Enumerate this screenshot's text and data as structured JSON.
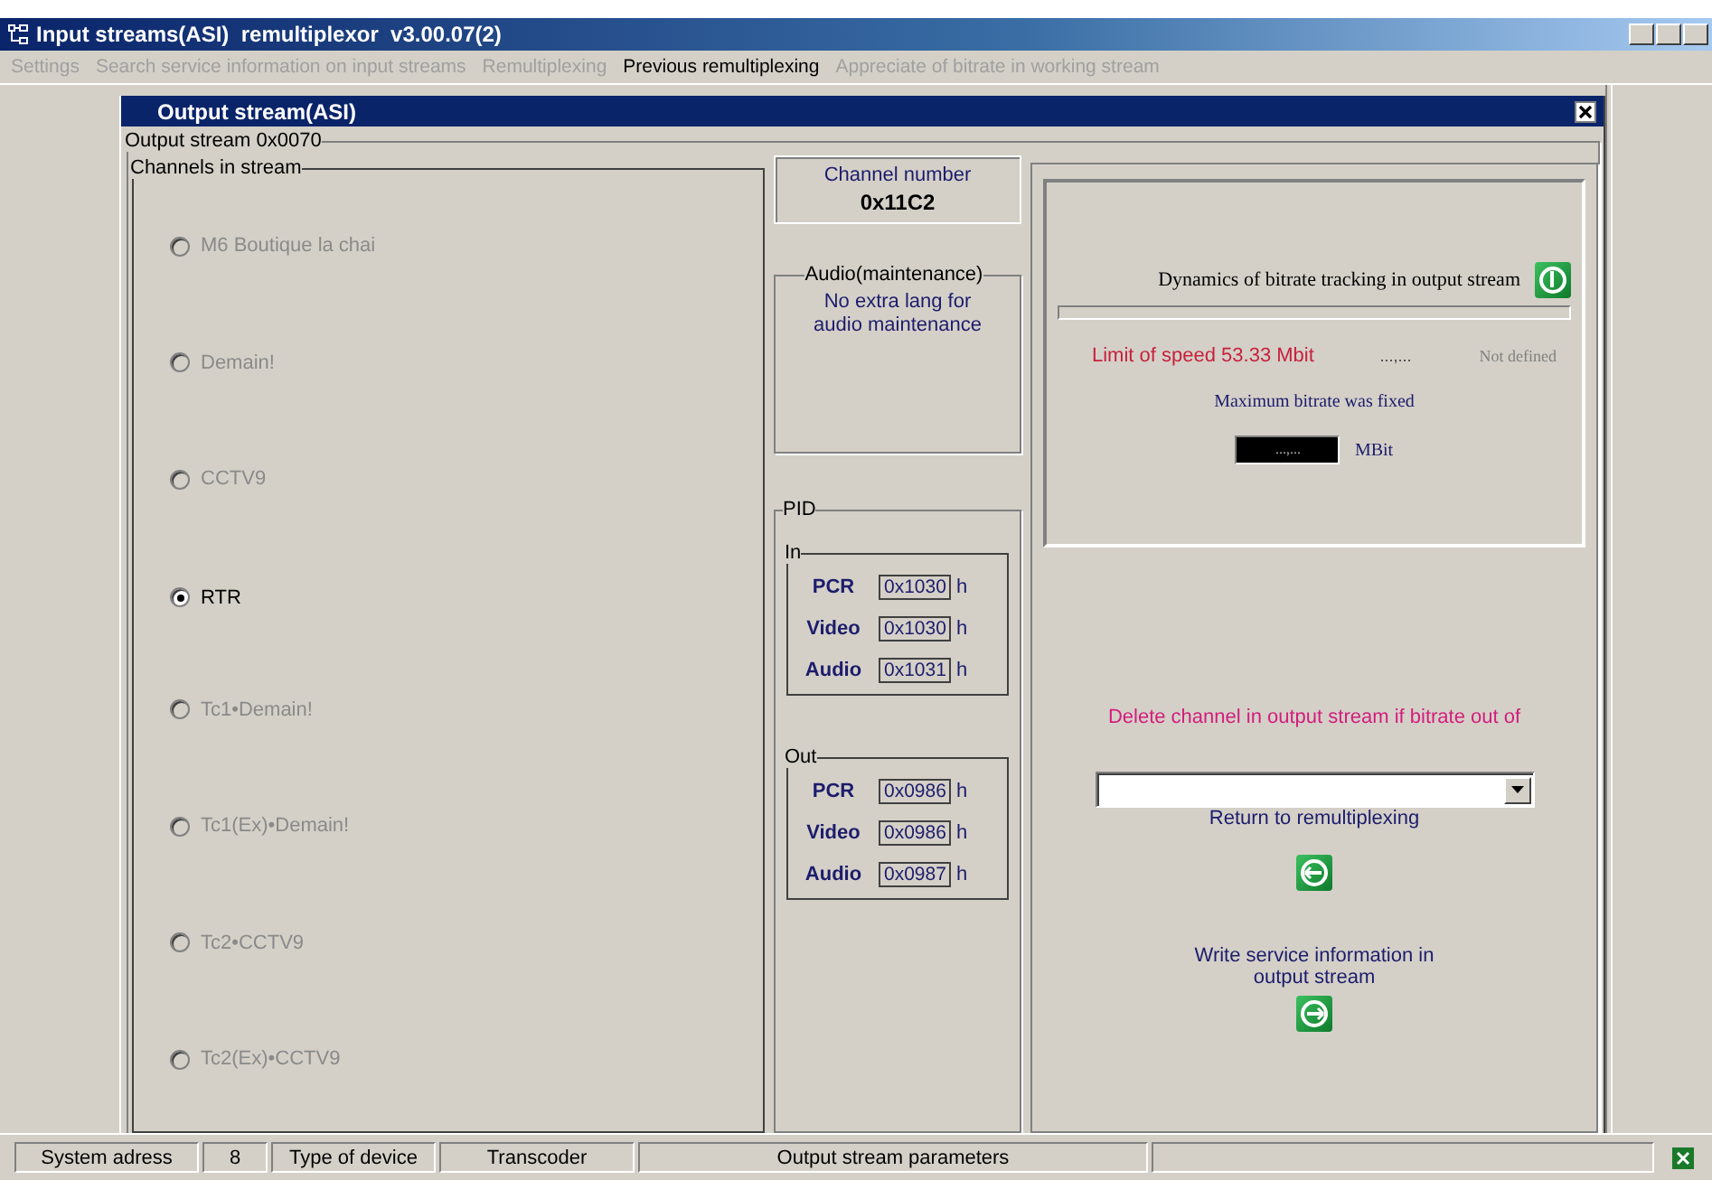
{
  "window": {
    "title": "Input streams(ASI)  remultiplexor  v3.00.07(2)"
  },
  "menu": [
    {
      "label": "Settings",
      "disabled": true
    },
    {
      "label": "Search service information on input streams",
      "disabled": true
    },
    {
      "label": "Remultiplexing",
      "disabled": true
    },
    {
      "label": "Previous remultiplexing",
      "disabled": false
    },
    {
      "label": "Appreciate of bitrate in working stream",
      "disabled": true
    }
  ],
  "dialog": {
    "title": "Output stream(ASI)",
    "group_title": "Output stream 0x0070"
  },
  "channels": {
    "title": "Channels in stream",
    "items": [
      {
        "label": "M6 Boutique la chai",
        "selected": false,
        "disabled": true
      },
      {
        "label": "Demain!",
        "selected": false,
        "disabled": true
      },
      {
        "label": "CCTV9",
        "selected": false,
        "disabled": true
      },
      {
        "label": "RTR",
        "selected": true,
        "disabled": false
      },
      {
        "label": "Tc1•Demain!",
        "selected": false,
        "disabled": true
      },
      {
        "label": "Tc1(Ex)•Demain!",
        "selected": false,
        "disabled": true
      },
      {
        "label": "Tc2•CCTV9",
        "selected": false,
        "disabled": true
      },
      {
        "label": "Tc2(Ex)•CCTV9",
        "selected": false,
        "disabled": true
      }
    ]
  },
  "channel_number": {
    "label": "Channel number",
    "value": "0x11C2"
  },
  "audio": {
    "title": "Audio(maintenance)",
    "text": "No extra lang for audio maintenance"
  },
  "pid": {
    "title": "PID",
    "groups": [
      {
        "title": "In",
        "rows": [
          {
            "label": "PCR",
            "value": "0x1030",
            "unit": "h"
          },
          {
            "label": "Video",
            "value": "0x1030",
            "unit": "h"
          },
          {
            "label": "Audio",
            "value": "0x1031",
            "unit": "h"
          }
        ]
      },
      {
        "title": "Out",
        "rows": [
          {
            "label": "PCR",
            "value": "0x0986",
            "unit": "h"
          },
          {
            "label": "Video",
            "value": "0x0986",
            "unit": "h"
          },
          {
            "label": "Audio",
            "value": "0x0987",
            "unit": "h"
          }
        ]
      }
    ]
  },
  "monitor": {
    "label": "Dynamics of bitrate tracking in output stream",
    "limit": "Limit of speed 53.33 Mbit",
    "reading": "...,...",
    "status": "Not defined",
    "fixed_label": "Maximum bitrate was fixed",
    "fixed_value": "...,...",
    "unit": "MBit"
  },
  "delete_label": "Delete channel in output stream if bitrate out of",
  "actions": [
    {
      "label": "Return to remultiplexing",
      "kind": "back"
    },
    {
      "label": "Write service information in output stream",
      "kind": "forward"
    }
  ],
  "status_bar": [
    "System adress",
    "8",
    "Type of device",
    "Transcoder",
    "Output stream parameters"
  ]
}
